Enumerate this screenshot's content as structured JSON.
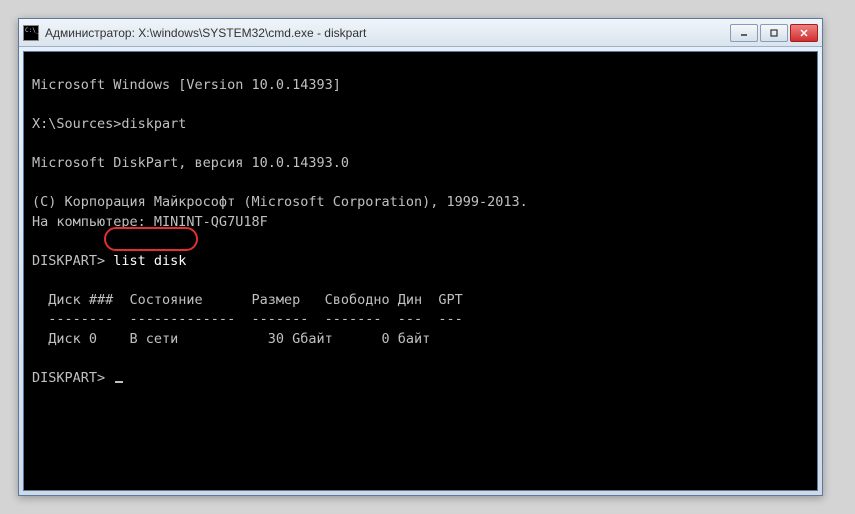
{
  "window": {
    "title": "Администратор: X:\\windows\\SYSTEM32\\cmd.exe - diskpart"
  },
  "console": {
    "line_version": "Microsoft Windows [Version 10.0.14393]",
    "line_prompt1_path": "X:\\Sources>",
    "line_prompt1_cmd": "diskpart",
    "line_diskpart_ver": "Microsoft DiskPart, версия 10.0.14393.0",
    "line_copyright": "(C) Корпорация Майкрософт (Microsoft Corporation), 1999-2013.",
    "line_computer": "На компьютере: MININT-QG7U18F",
    "line_dp_prompt1": "DISKPART> ",
    "line_dp_cmd1": "list disk",
    "table": {
      "header": "  Диск ###  Состояние      Размер   Свободно Дин  GPT",
      "divider": "  --------  -------------  -------  -------  ---  ---",
      "row0": "  Диск 0    В сети           30 Gбайт      0 байт"
    },
    "line_dp_prompt2": "DISKPART> "
  }
}
